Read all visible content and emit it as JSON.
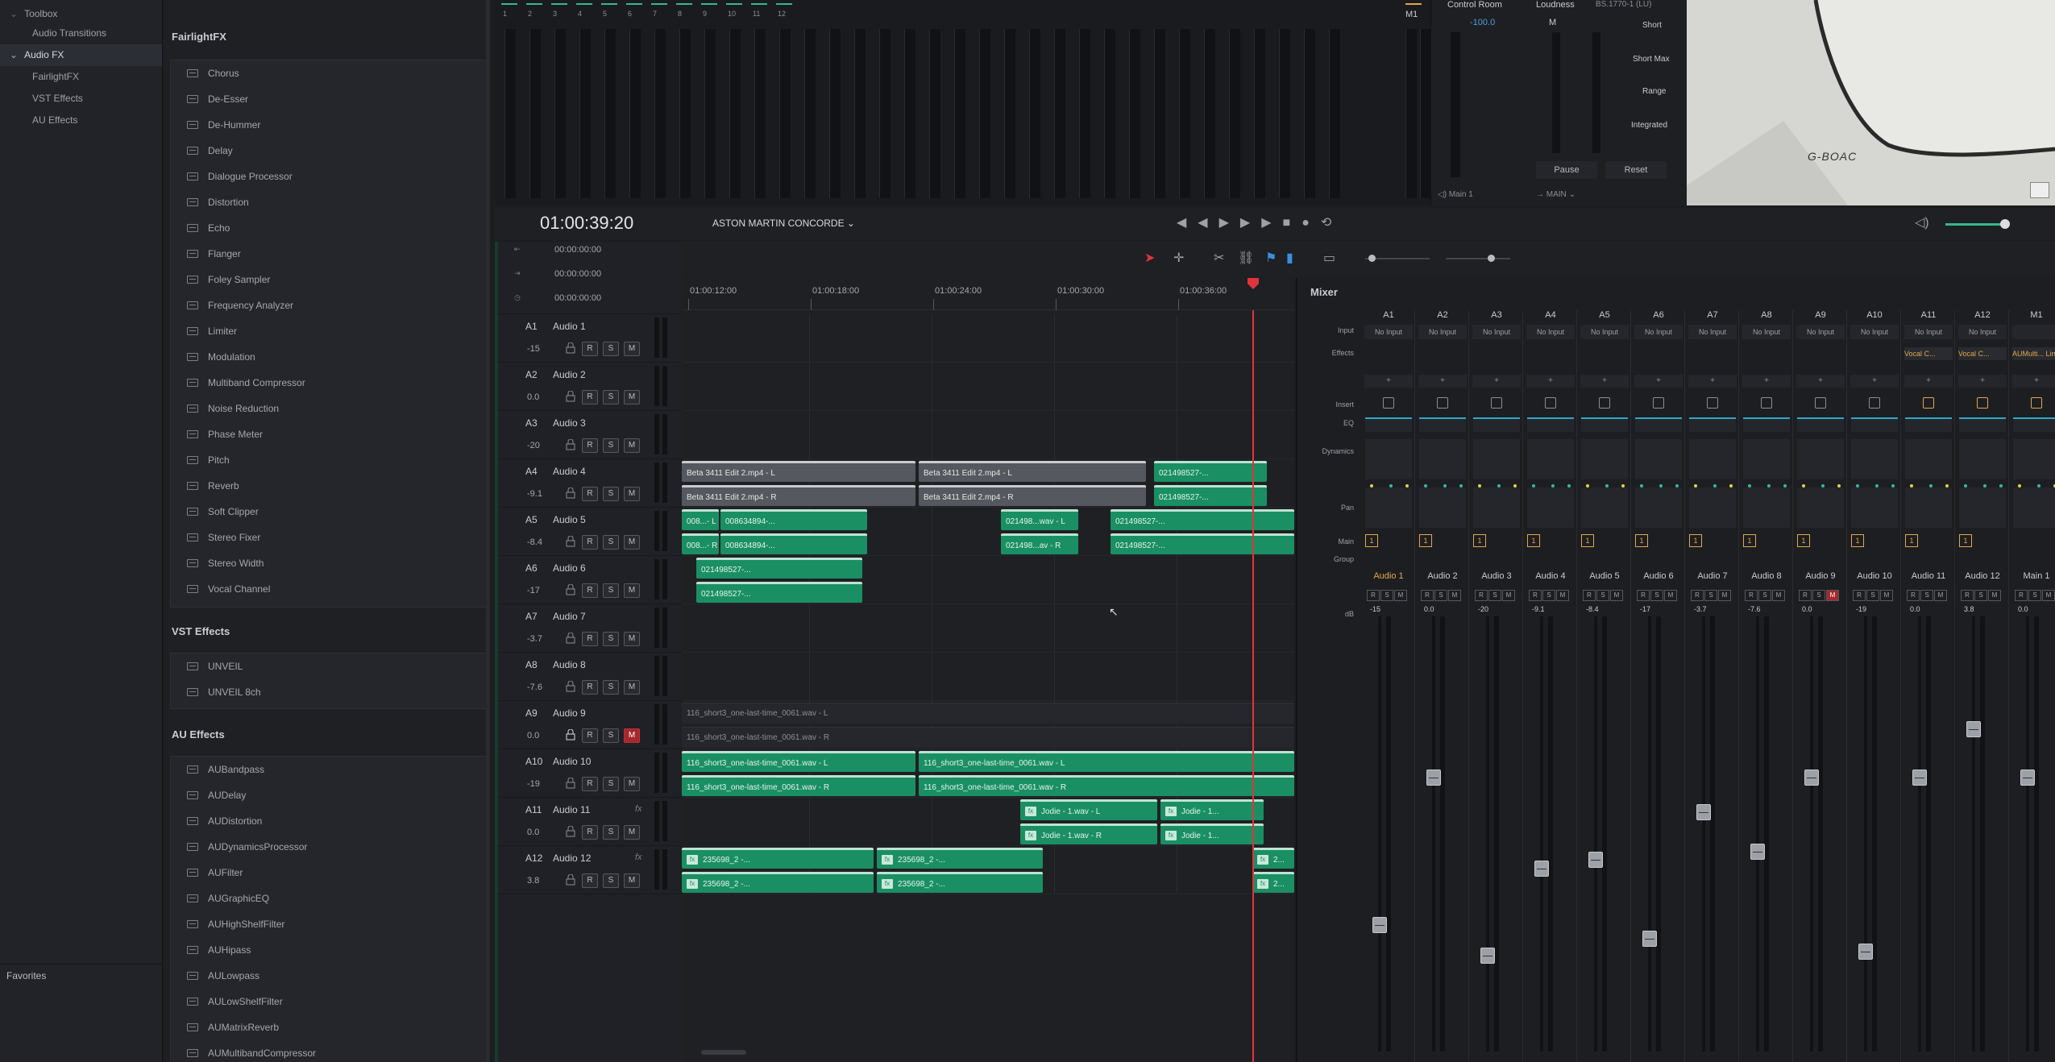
{
  "toolbox": {
    "items": [
      {
        "label": "Toolbox",
        "expanded": true
      },
      {
        "label": "Audio Transitions"
      },
      {
        "label": "Audio FX",
        "expanded": true,
        "selected": true
      },
      {
        "label": "FairlightFX"
      },
      {
        "label": "VST Effects"
      },
      {
        "label": "AU Effects"
      }
    ],
    "favorites_label": "Favorites"
  },
  "fx_panel": {
    "fairlight_title": "FairlightFX",
    "fairlight_items": [
      "Chorus",
      "De-Esser",
      "De-Hummer",
      "Delay",
      "Dialogue Processor",
      "Distortion",
      "Echo",
      "Flanger",
      "Foley Sampler",
      "Frequency Analyzer",
      "Limiter",
      "Modulation",
      "Multiband Compressor",
      "Noise Reduction",
      "Phase Meter",
      "Pitch",
      "Reverb",
      "Soft Clipper",
      "Stereo Fixer",
      "Stereo Width",
      "Vocal Channel"
    ],
    "vst_title": "VST Effects",
    "vst_items": [
      "UNVEIL",
      "UNVEIL 8ch"
    ],
    "au_title": "AU Effects",
    "au_items": [
      "AUBandpass",
      "AUDelay",
      "AUDistortion",
      "AUDynamicsProcessor",
      "AUFilter",
      "AUGraphicEQ",
      "AUHighShelfFilter",
      "AUHipass",
      "AULowpass",
      "AULowShelfFilter",
      "AUMatrixReverb",
      "AUMultibandCompressor"
    ]
  },
  "meters": {
    "channel_numbers": [
      "1",
      "2",
      "3",
      "4",
      "5",
      "6",
      "7",
      "8",
      "9",
      "10",
      "11",
      "12"
    ],
    "bus_label": "M1"
  },
  "control_room": {
    "title": "Control Room",
    "value": "-100.0",
    "loudness_label": "Loudness",
    "loudness_value": "BS.1770-1 (LU)",
    "m_label": "M",
    "short": "Short",
    "short_max": "Short Max",
    "range": "Range",
    "integrated": "Integrated",
    "pause": "Pause",
    "reset": "Reset",
    "main_output": "Main 1",
    "main_bus": "MAIN"
  },
  "viewer": {
    "plate": "G-BOAC"
  },
  "transport": {
    "timecode": "01:00:39:20",
    "project": "ASTON MARTIN CONCORDE",
    "sub_timecodes": [
      "00:00:00:00",
      "00:00:00:00",
      "00:00:00:00"
    ]
  },
  "ruler": [
    "01:00:12:00",
    "01:00:18:00",
    "01:00:24:00",
    "01:00:30:00",
    "01:00:36:00"
  ],
  "tracks": [
    {
      "id": "A1",
      "name": "Audio 1",
      "vol": "-15",
      "fx": ""
    },
    {
      "id": "A2",
      "name": "Audio 2",
      "vol": "0.0",
      "fx": ""
    },
    {
      "id": "A3",
      "name": "Audio 3",
      "vol": "-20",
      "fx": ""
    },
    {
      "id": "A4",
      "name": "Audio 4",
      "vol": "-9.1",
      "fx": ""
    },
    {
      "id": "A5",
      "name": "Audio 5",
      "vol": "-8.4",
      "fx": ""
    },
    {
      "id": "A6",
      "name": "Audio 6",
      "vol": "-17",
      "fx": ""
    },
    {
      "id": "A7",
      "name": "Audio 7",
      "vol": "-3.7",
      "fx": ""
    },
    {
      "id": "A8",
      "name": "Audio 8",
      "vol": "-7.6",
      "fx": ""
    },
    {
      "id": "A9",
      "name": "Audio 9",
      "vol": "0.0",
      "fx": "",
      "mute": true
    },
    {
      "id": "A10",
      "name": "Audio 10",
      "vol": "-19",
      "fx": ""
    },
    {
      "id": "A11",
      "name": "Audio 11",
      "vol": "0.0",
      "fx": "fx"
    },
    {
      "id": "A12",
      "name": "Audio 12",
      "vol": "3.8",
      "fx": "fx"
    }
  ],
  "track_buttons": {
    "r": "R",
    "s": "S",
    "m": "M"
  },
  "clips": {
    "a4_l1": "Beta 3411 Edit 2.mp4 - L",
    "a4_r1": "Beta 3411 Edit 2.mp4 - R",
    "a4_l2": "Beta 3411 Edit 2.mp4 - L",
    "a4_r2": "Beta 3411 Edit 2.mp4 - R",
    "a4_l3": "021498527-...",
    "a4_r3": "021498527-...",
    "a5_l1": "008...- L",
    "a5_l2": "008634894-...",
    "a5_r1": "008...- R",
    "a5_r2": "008634894-...",
    "a5_l3": "021498...wav - L",
    "a5_r3": "021498...av - R",
    "a5_l4": "021498527-...",
    "a5_r4": "021498527-...",
    "a6_l": "021498527-...",
    "a6_r": "021498527-...",
    "a9_l": "116_short3_one-last-time_0061.wav - L",
    "a9_r": "116_short3_one-last-time_0061.wav - R",
    "a10_l1": "116_short3_one-last-time_0061.wav - L",
    "a10_r1": "116_short3_one-last-time_0061.wav - R",
    "a10_l2": "116_short3_one-last-time_0061.wav - L",
    "a10_r2": "116_short3_one-last-time_0061.wav - R",
    "a11_l1": "Jodie - 1.wav - L",
    "a11_r1": "Jodie - 1.wav - R",
    "a11_l2": "Jodie - 1...",
    "a11_r2": "Jodie - 1...",
    "a12_l1": "235698_2 -...",
    "a12_r1": "235698_2 -...",
    "a12_l2": "235698_2 -...",
    "a12_r2": "235698_2 -...",
    "a12_l3": "2...",
    "a12_r3": "2..."
  },
  "mixer": {
    "title": "Mixer",
    "row_labels": {
      "input": "Input",
      "effects": "Effects",
      "insert": "Insert",
      "eq": "EQ",
      "dynamics": "Dynamics",
      "pan": "Pan",
      "main": "Main",
      "group": "Group",
      "db": "dB"
    },
    "channels": [
      {
        "label": "A1",
        "input": "No Input",
        "effect": "",
        "name": "Audio 1",
        "db": "-15",
        "active": true,
        "fader": 0.71
      },
      {
        "label": "A2",
        "input": "No Input",
        "effect": "",
        "name": "Audio 2",
        "db": "0.0",
        "fader": 0.37
      },
      {
        "label": "A3",
        "input": "No Input",
        "effect": "",
        "name": "Audio 3",
        "db": "-20",
        "fader": 0.78
      },
      {
        "label": "A4",
        "input": "No Input",
        "effect": "",
        "name": "Audio 4",
        "db": "-9.1",
        "fader": 0.58
      },
      {
        "label": "A5",
        "input": "No Input",
        "effect": "",
        "name": "Audio 5",
        "db": "-8.4",
        "fader": 0.56
      },
      {
        "label": "A6",
        "input": "No Input",
        "effect": "",
        "name": "Audio 6",
        "db": "-17",
        "fader": 0.74
      },
      {
        "label": "A7",
        "input": "No Input",
        "effect": "",
        "name": "Audio 7",
        "db": "-3.7",
        "fader": 0.45
      },
      {
        "label": "A8",
        "input": "No Input",
        "effect": "",
        "name": "Audio 8",
        "db": "-7.6",
        "fader": 0.54
      },
      {
        "label": "A9",
        "input": "No Input",
        "effect": "",
        "name": "Audio 9",
        "db": "0.0",
        "fader": 0.37,
        "mute": true
      },
      {
        "label": "A10",
        "input": "No Input",
        "effect": "",
        "name": "Audio 10",
        "db": "-19",
        "fader": 0.77
      },
      {
        "label": "A11",
        "input": "No Input",
        "effect": "Vocal C...",
        "name": "Audio 11",
        "db": "0.0",
        "fader": 0.37
      },
      {
        "label": "A12",
        "input": "No Input",
        "effect": "Vocal C...",
        "name": "Audio 12",
        "db": "3.8",
        "fader": 0.26
      },
      {
        "label": "M1",
        "input": "",
        "effect": "AUMulti... Limiter",
        "name": "Main 1",
        "db": "0.0",
        "fader": 0.37
      }
    ],
    "rsm": {
      "r": "R",
      "s": "S",
      "m": "M"
    }
  },
  "colors": {
    "accent": "#e0a84a",
    "clip": "#1a8f63",
    "mute": "#a4282c",
    "playhead": "#e0343a"
  }
}
